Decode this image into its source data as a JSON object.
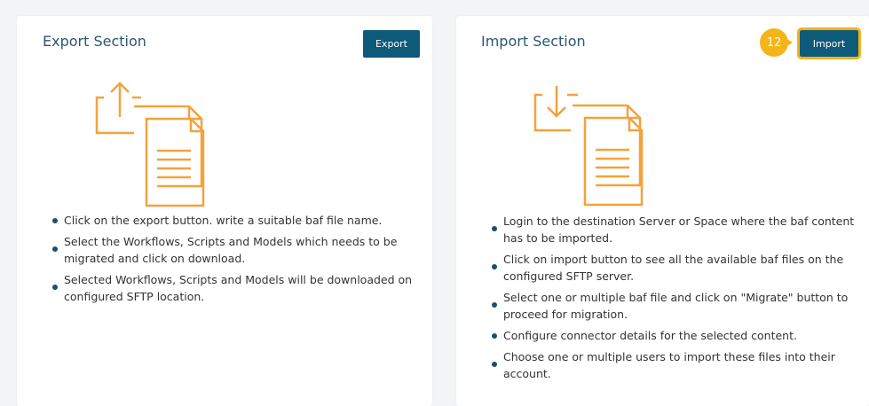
{
  "export_section": {
    "title": "Export Section",
    "button_label": "Export",
    "steps": [
      "Click on the export button. write a suitable baf file name.",
      "Select the Workflows, Scripts and Models which needs to be migrated and click on download.",
      "Selected Workflows, Scripts and Models will be downloaded on configured SFTP location."
    ]
  },
  "import_section": {
    "title": "Import Section",
    "button_label": "Import",
    "callout_number": "12",
    "steps": [
      "Login to the destination Server or Space where the baf content has to be imported.",
      "Click on import button to see all the available baf files on the configured SFTP server.",
      "Select one or multiple baf file and click on \"Migrate\" button to proceed for migration.",
      "Configure connector details for the selected content.",
      "Choose one or multiple users to import these files into their account."
    ]
  },
  "colors": {
    "accent_orange": "#f4a23c",
    "button_teal": "#0d5a7a",
    "title_blue": "#2a5673",
    "callout_yellow": "#f4b41a"
  },
  "icons": {
    "export_illustration": "file-upload-icon",
    "import_illustration": "file-download-icon"
  }
}
